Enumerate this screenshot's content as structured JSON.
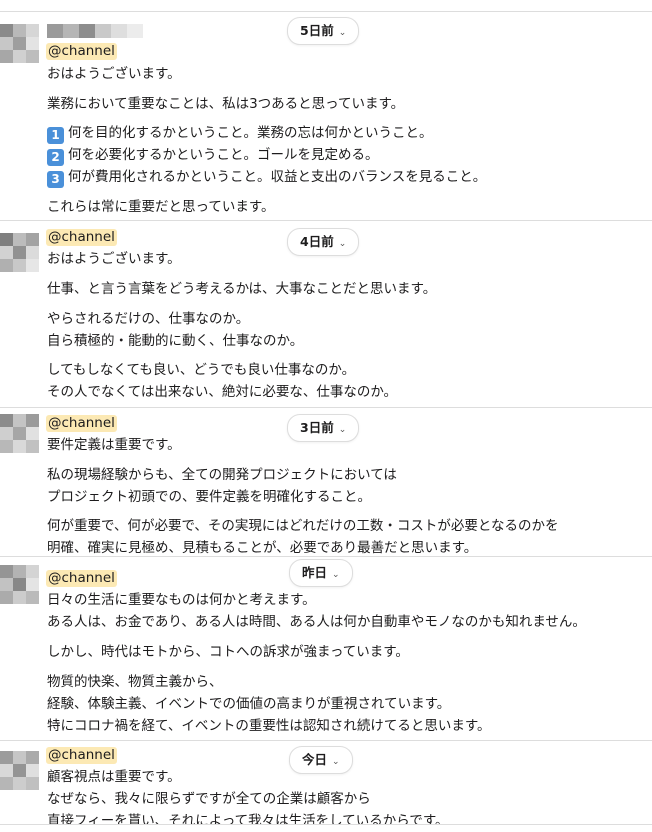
{
  "messages": [
    {
      "date": "5日前",
      "mention": "@channel",
      "lines": [
        "おはようございます。",
        "業務において重要なことは、私は3つあると思っています。",
        "何を目的化するかということ。業務の忘は何かということ。",
        "何を必要化するかということ。ゴールを見定める。",
        "何が費用化されるかということ。収益と支出のバランスを見ること。",
        "これらは常に重要だと思っています。"
      ],
      "keycaps": [
        "1",
        "2",
        "3"
      ]
    },
    {
      "date": "4日前",
      "mention": "@channel",
      "lines": [
        "おはようございます。",
        "仕事、と言う言葉をどう考えるかは、大事なことだと思います。",
        "やらされるだけの、仕事なのか。",
        "自ら積極的・能動的に動く、仕事なのか。",
        "してもしなくても良い、どうでも良い仕事なのか。",
        "その人でなくては出来ない、絶対に必要な、仕事なのか。"
      ]
    },
    {
      "date": "3日前",
      "mention": "@channel",
      "lines": [
        "要件定義は重要です。",
        "私の現場経験からも、全ての開発プロジェクトにおいては",
        "プロジェクト初頭での、要件定義を明確化すること。",
        "何が重要で、何が必要で、その実現にはどれだけの工数・コストが必要となるのかを",
        "明確、確実に見極め、見積もることが、必要であり最善だと思います。"
      ]
    },
    {
      "date": "昨日",
      "mention": "@channel",
      "lines": [
        "日々の生活に重要なものは何かと考えます。",
        "ある人は、お金であり、ある人は時間、ある人は何か自動車やモノなのかも知れません。",
        "しかし、時代はモトから、コトへの訴求が強まっています。",
        "物質的快楽、物質主義から、",
        "経験、体験主義、イベントでの価値の高まりが重視されています。",
        "特にコロナ禍を経て、イベントの重要性は認知され続けてると思います。"
      ]
    },
    {
      "date": "今日",
      "mention": "@channel",
      "lines": [
        "顧客視点は重要です。",
        "なぜなら、我々に限らずですが全ての企業は顧客から",
        "直接フィーを貰い、それによって我々は生活をしているからです。"
      ]
    }
  ],
  "colors": {
    "mention_bg": "#fce9b4",
    "keycap": "#4a90d9",
    "divider": "#dddddd",
    "text": "#1d1c1d"
  },
  "icons": {
    "chevron": "chevron-down-icon"
  }
}
